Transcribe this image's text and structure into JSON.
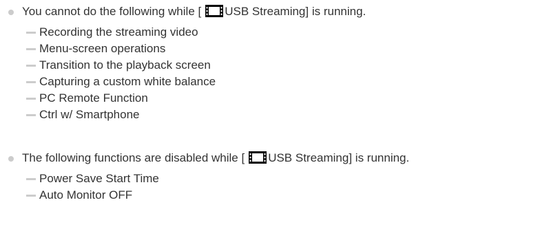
{
  "notes": [
    {
      "prefix": "You cannot do the following while [",
      "icon": "movie-mode-icon",
      "suffix": "USB Streaming] is running.",
      "items": [
        "Recording the streaming video",
        "Menu-screen operations",
        "Transition to the playback screen",
        "Capturing a custom white balance",
        "PC Remote Function",
        "Ctrl w/ Smartphone"
      ]
    },
    {
      "prefix": "The following functions are disabled while [",
      "icon": "movie-mode-icon",
      "suffix": "USB Streaming] is running.",
      "items": [
        "Power Save Start Time",
        "Auto Monitor OFF"
      ]
    }
  ],
  "colors": {
    "text": "#333333",
    "bullet": "#cccccc",
    "icon": "#000000"
  }
}
